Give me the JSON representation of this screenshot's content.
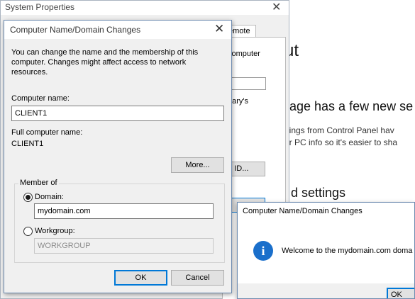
{
  "settings_window": {
    "heading_fragment": "ut",
    "section_heading": "age has a few new se",
    "body_line1": "ttings from Control Panel hav",
    "body_line2": "ur PC info so it's easier to sha",
    "section_heading2": "d settings"
  },
  "system_properties": {
    "title": "System Properties",
    "close_glyph": "✕",
    "tab_fragment": "emote",
    "text_fragment1": "computer",
    "text_fragment2": "dary's",
    "button_fragment": "rk ID..."
  },
  "dialog": {
    "title": "Computer Name/Domain Changes",
    "close_glyph": "✕",
    "description": "You can change the name and the membership of this computer. Changes might affect access to network resources.",
    "computer_name_label": "Computer name:",
    "computer_name_value": "CLIENT1",
    "full_name_label": "Full computer name:",
    "full_name_value": "CLIENT1",
    "more_button": "More...",
    "member_of_label": "Member of",
    "domain_label": "Domain:",
    "domain_value": "mydomain.com",
    "domain_selected": true,
    "workgroup_label": "Workgroup:",
    "workgroup_value": "WORKGROUP",
    "ok_button": "OK",
    "cancel_button": "Cancel"
  },
  "message_box": {
    "title": "Computer Name/Domain Changes",
    "icon": "info-icon",
    "icon_glyph": "i",
    "text": "Welcome to the mydomain.com doma",
    "ok_fragment": "OK"
  },
  "colors": {
    "accent": "#0078d7",
    "info_icon": "#1a6fcb",
    "dialog_bg": "#f0f0f0"
  }
}
